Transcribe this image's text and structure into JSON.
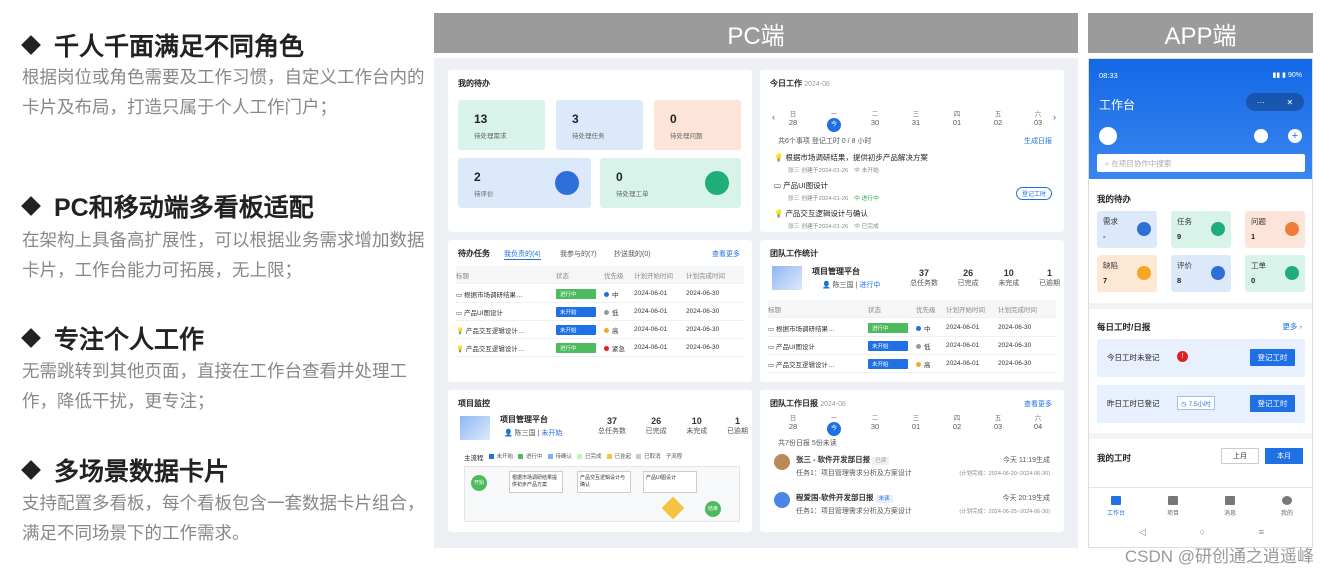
{
  "features": [
    {
      "title": "千人千面满足不同角色",
      "desc": "根据岗位或角色需要及工作习惯，自定义工作台内的卡片及布局，打造只属于个人工作门户；"
    },
    {
      "title": "PC和移动端多看板适配",
      "desc": "在架构上具备高扩展性，可以根据业务需求增加数据卡片，工作台能力可拓展，无上限；"
    },
    {
      "title": "专注个人工作",
      "desc": "无需跳转到其他页面，直接在工作台查看并处理工作，降低干扰，更专注；"
    },
    {
      "title": "多场景数据卡片",
      "desc": "支持配置多看板，每个看板包含一套数据卡片组合，满足不同场景下的工作需求。"
    }
  ],
  "headers": {
    "pc": "PC端",
    "app": "APP端"
  },
  "pc": {
    "todo": {
      "title": "我的待办",
      "stats": [
        {
          "n": "13",
          "l": "待处理需求"
        },
        {
          "n": "3",
          "l": "待处理任务"
        },
        {
          "n": "0",
          "l": "待处理问题"
        },
        {
          "n": "2",
          "l": "待评价"
        },
        {
          "n": "0",
          "l": "待处理工单"
        }
      ]
    },
    "today": {
      "title": "今日工作",
      "date": "2024-06",
      "days": [
        {
          "w": "日",
          "d": "28"
        },
        {
          "w": "一",
          "d": "今"
        },
        {
          "w": "二",
          "d": "30"
        },
        {
          "w": "三",
          "d": "31"
        },
        {
          "w": "四",
          "d": "01"
        },
        {
          "w": "五",
          "d": "02"
        },
        {
          "w": "六",
          "d": "03"
        }
      ],
      "summary": "共6个事项  登记工时 0 / 8 小时",
      "gen": "生成日报",
      "log": "登记工时",
      "items": [
        {
          "t": "根据市场调研结果，提供初步产品解决方案",
          "m": "张三  创建于2024-01-26",
          "s": "中  未开始"
        },
        {
          "t": "产品UI图设计",
          "m": "张三  创建于2024-01-26",
          "s": "中  进行中"
        },
        {
          "t": "产品交互逻辑设计与确认",
          "m": "张三  创建于2024-01-26",
          "s": "中  已完成"
        }
      ]
    },
    "tasks": {
      "title": "待办任务",
      "tabs": [
        "我负责的(4)",
        "我参与的(7)",
        "抄送我的(0)"
      ],
      "more": "查看更多",
      "cols": [
        "标题",
        "状态",
        "优先级",
        "计划开始时间",
        "计划完成时间"
      ],
      "rows": [
        {
          "t": "根据市场调研结果…",
          "s": "进行中",
          "p": "中",
          "a": "2024-06-01",
          "b": "2024-06-30"
        },
        {
          "t": "产品UI图设计",
          "s": "未开始",
          "p": "低",
          "a": "2024-06-01",
          "b": "2024-06-30"
        },
        {
          "t": "产品交互逻辑设计…",
          "s": "未开始",
          "p": "高",
          "a": "2024-06-01",
          "b": "2024-06-30"
        },
        {
          "t": "产品交互逻辑设计…",
          "s": "进行中",
          "p": "紧急",
          "a": "2024-06-01",
          "b": "2024-06-30"
        }
      ]
    },
    "team": {
      "title": "团队工作统计",
      "project": "项目管理平台",
      "owner": "陈三国",
      "status": "进行中",
      "nums": [
        {
          "n": "37",
          "l": "总任务数"
        },
        {
          "n": "26",
          "l": "已完成"
        },
        {
          "n": "10",
          "l": "未完成"
        },
        {
          "n": "1",
          "l": "已逾期"
        }
      ],
      "cols": [
        "标题",
        "状态",
        "优先级",
        "计划开始时间",
        "计划完成时间"
      ],
      "rows": [
        {
          "t": "根据市场调研结果…",
          "s": "进行中",
          "p": "中",
          "a": "2024-06-01",
          "b": "2024-06-30"
        },
        {
          "t": "产品UI图设计",
          "s": "未开始",
          "p": "低",
          "a": "2024-06-01",
          "b": "2024-06-30"
        },
        {
          "t": "产品交互逻辑设计…",
          "s": "未开始",
          "p": "高",
          "a": "2024-06-01",
          "b": "2024-06-30"
        }
      ]
    },
    "monitor": {
      "title": "项目监控",
      "project": "项目管理平台",
      "owner": "陈三国",
      "status": "未开始",
      "nums": [
        {
          "n": "37",
          "l": "总任务数"
        },
        {
          "n": "26",
          "l": "已完成"
        },
        {
          "n": "10",
          "l": "未完成"
        },
        {
          "n": "1",
          "l": "已逾期"
        }
      ],
      "legend": [
        "主流程",
        "未开始",
        "进行中",
        "待确认",
        "已完成",
        "已挂起",
        "已取消",
        "子流程"
      ],
      "nodes": [
        "根据市场调研结果提供初步产品方案",
        "产品交互逻辑设计与确认",
        "产品UI图设计"
      ],
      "start": "开始",
      "end": "结束"
    },
    "daily": {
      "title": "团队工作日报",
      "date": "2024-06",
      "more": "查看更多",
      "days": [
        {
          "w": "日",
          "d": "28"
        },
        {
          "w": "一",
          "d": "今"
        },
        {
          "w": "二",
          "d": "30"
        },
        {
          "w": "三",
          "d": "01"
        },
        {
          "w": "四",
          "d": "02"
        },
        {
          "w": "五",
          "d": "03"
        },
        {
          "w": "六",
          "d": "04"
        }
      ],
      "summary": "共7份日报  5份未读",
      "items": [
        {
          "name": "张三 - 软件开发部日报",
          "tag": "已读",
          "time": "今天 11:19生成",
          "task": "任务1：项目管理需求分析及方案设计",
          "plan": "(计划完成：2024-06-20~2024-06-30)"
        },
        {
          "name": "程爱国-软件开发部日报",
          "tag": "未读",
          "time": "今天 20:19生成",
          "task": "任务1：项目管理需求分析及方案设计",
          "plan": "(计划完成：2024-06-25~2024-06-30)"
        }
      ]
    }
  },
  "app": {
    "time": "08:33",
    "battery": "90%",
    "title": "工作台",
    "search": "在项目协作中搜索",
    "todo": "我的待办",
    "tiles": [
      {
        "t": "需求",
        "v": "-"
      },
      {
        "t": "任务",
        "v": "9"
      },
      {
        "t": "问题",
        "v": "1"
      },
      {
        "t": "缺陷",
        "v": "7"
      },
      {
        "t": "评价",
        "v": "8"
      },
      {
        "t": "工单",
        "v": "0"
      }
    ],
    "hours": "每日工时/日报",
    "more": "更多",
    "today": "今日工时未登记",
    "yesterday": "昨日工时已登记",
    "yhours": "7.5小时",
    "log": "登记工时",
    "mywork": "我的工时",
    "last": "上月",
    "cur": "本月",
    "nav": [
      "工作台",
      "项目",
      "消息",
      "我的"
    ]
  },
  "watermark": "CSDN @研创通之逍遥峰"
}
